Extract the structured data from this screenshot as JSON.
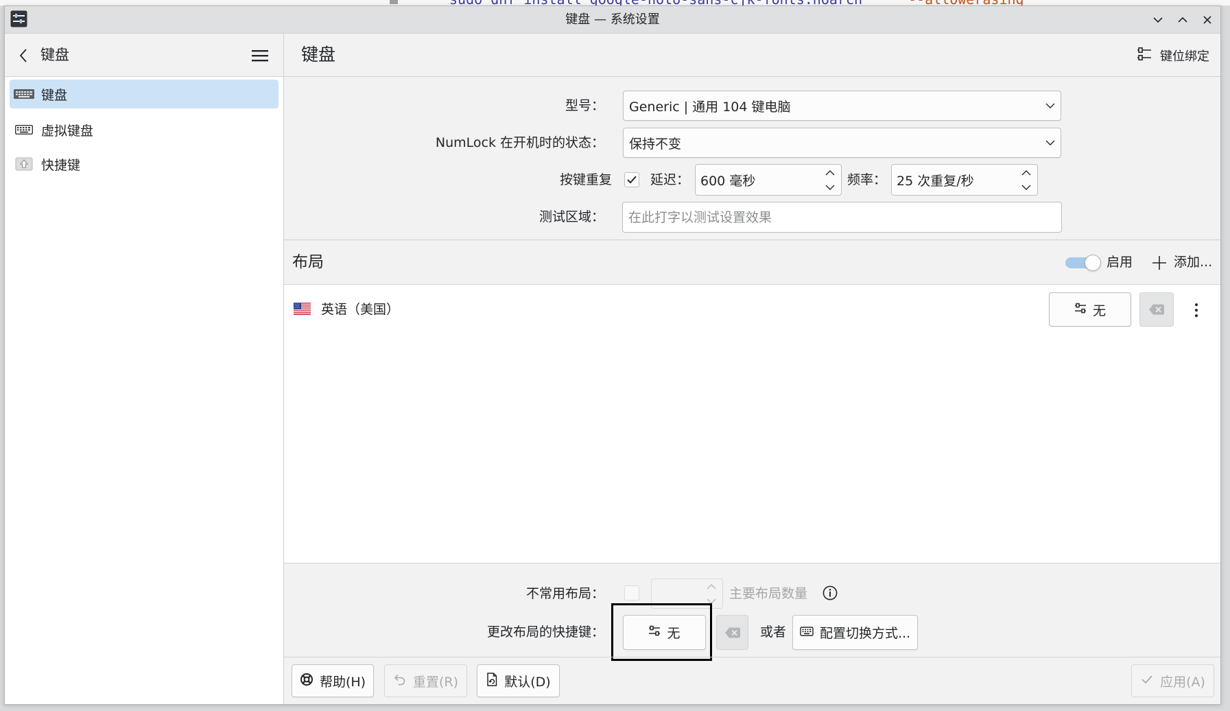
{
  "theme": {
    "selection": "#cce2f6",
    "toggle_track": "#a6caec",
    "annotation_box": "#000000"
  },
  "background": {
    "terminal_command": "sudo dnf install google-noto-sans-cjk-fonts.noarch",
    "terminal_flag": "--allowerasing"
  },
  "window": {
    "title": "键盘 — 系统设置",
    "app_icon": "system-settings-icon",
    "controls": [
      "minimize-icon",
      "maximize-icon",
      "close-icon"
    ]
  },
  "sidebar": {
    "title": "键盘",
    "items": [
      {
        "label": "键盘",
        "icon": "keyboard-icon",
        "selected": true
      },
      {
        "label": "虚拟键盘",
        "icon": "virtual-keyboard-icon",
        "selected": false
      },
      {
        "label": "快捷键",
        "icon": "shortcut-key-icon",
        "selected": false
      }
    ]
  },
  "page": {
    "title": "键盘",
    "key_bindings_button": "键位绑定"
  },
  "form": {
    "model": {
      "label": "型号：",
      "value": "Generic | 通用 104 键电脑"
    },
    "numlock": {
      "label": "NumLock 在开机时的状态：",
      "value": "保持不变"
    },
    "key_repeat": {
      "label": "按键重复",
      "enabled": true,
      "delay_label": "延迟：",
      "delay_value": "600 毫秒",
      "rate_label": "频率：",
      "rate_value": "25 次重复/秒"
    },
    "test_area": {
      "label": "测试区域：",
      "placeholder": "在此打字以测试设置效果"
    }
  },
  "layouts": {
    "title": "布局",
    "toggle_label": "启用",
    "toggle_on": true,
    "add_button": "添加...",
    "items": [
      {
        "name": "英语（美国）",
        "flag": "us-flag-icon",
        "shortcut": "无"
      }
    ]
  },
  "advanced": {
    "spare_layouts_label": "不常用布局：",
    "spare_layouts_enabled": false,
    "spare_layouts_hint": "主要布局数量",
    "switch_shortcut_label": "更改布局的快捷键：",
    "switch_shortcut_value": "无",
    "or_label": "或者",
    "configure_switching_button": "配置切换方式..."
  },
  "buttons": {
    "help": "帮助(H)",
    "reset": "重置(R)",
    "defaults": "默认(D)",
    "apply": "应用(A)"
  }
}
